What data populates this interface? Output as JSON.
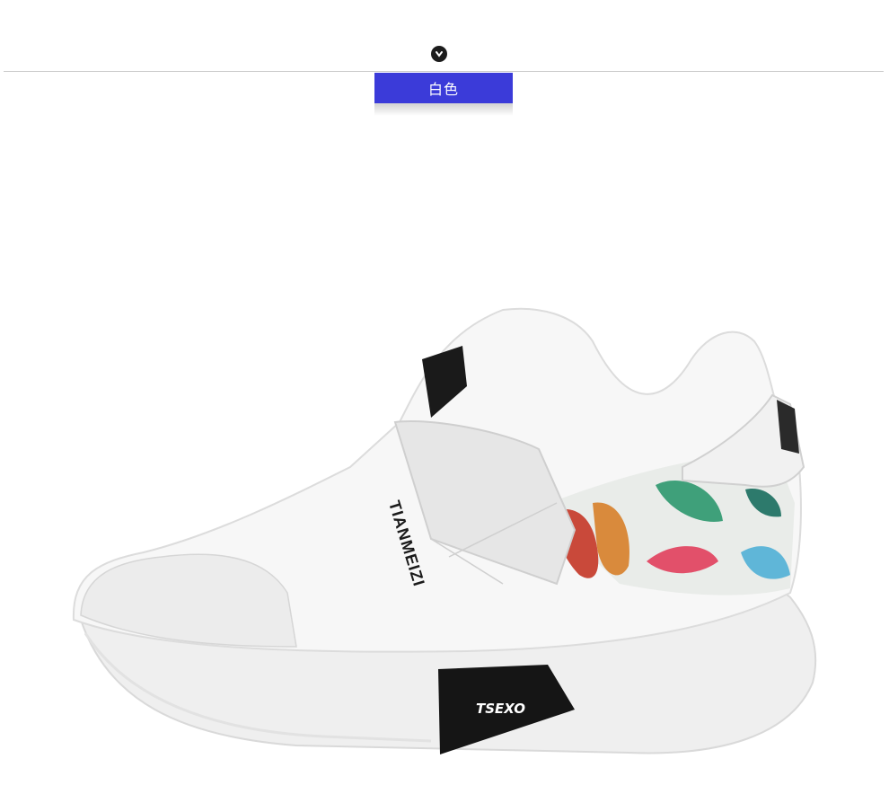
{
  "header": {
    "toggle_icon": "chevron-down-icon",
    "color_tab_label": "白色",
    "accent_color": "#3b3bd9"
  },
  "product": {
    "strap_brand": "TIANMEIZI",
    "sole_brand": "TSEXO"
  }
}
